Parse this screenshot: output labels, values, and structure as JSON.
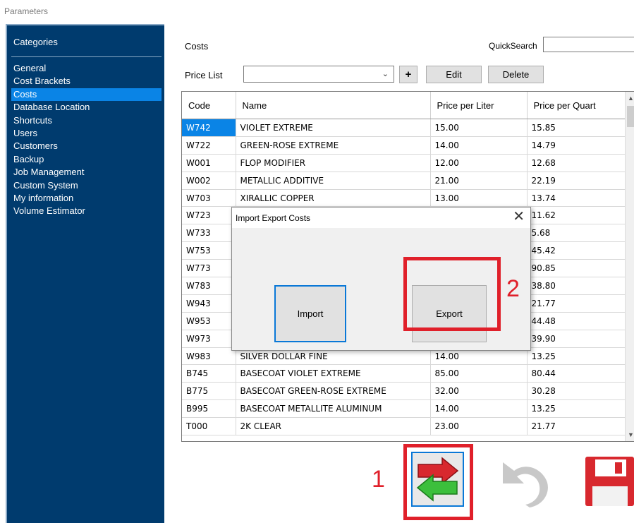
{
  "window": {
    "title": "Parameters"
  },
  "sidebar": {
    "title": "Categories",
    "items": [
      {
        "label": "General"
      },
      {
        "label": "Cost Brackets"
      },
      {
        "label": "Costs",
        "selected": true
      },
      {
        "label": "Database Location"
      },
      {
        "label": "Shortcuts"
      },
      {
        "label": "Users"
      },
      {
        "label": "Customers"
      },
      {
        "label": "Backup"
      },
      {
        "label": "Job Management"
      },
      {
        "label": "Custom System"
      },
      {
        "label": "My information"
      },
      {
        "label": "Volume Estimator"
      }
    ]
  },
  "header": {
    "section_title": "Costs",
    "quicksearch_label": "QuickSearch",
    "quicksearch_value": "",
    "price_list_label": "Price List",
    "price_list_value": "",
    "add_label": "+",
    "edit_label": "Edit",
    "delete_label": "Delete"
  },
  "table": {
    "columns": [
      "Code",
      "Name",
      "Price per Liter",
      "Price per Quart"
    ],
    "rows": [
      [
        "W742",
        "VIOLET EXTREME",
        "15.00",
        "15.85"
      ],
      [
        "W722",
        "GREEN-ROSE EXTREME",
        "14.00",
        "14.79"
      ],
      [
        "W001",
        "FLOP MODIFIER",
        "12.00",
        "12.68"
      ],
      [
        "W002",
        "METALLIC ADDITIVE",
        "21.00",
        "22.19"
      ],
      [
        "W703",
        "XIRALLIC COPPER",
        "13.00",
        "13.74"
      ],
      [
        "W723",
        "",
        "",
        "11.62"
      ],
      [
        "W733",
        "",
        "",
        "5.68"
      ],
      [
        "W753",
        "",
        "",
        "45.42"
      ],
      [
        "W773",
        "",
        "",
        "90.85"
      ],
      [
        "W783",
        "",
        "",
        "38.80"
      ],
      [
        "W943",
        "",
        "",
        "21.77"
      ],
      [
        "W953",
        "",
        "",
        "44.48"
      ],
      [
        "W973",
        "",
        "",
        "39.90"
      ],
      [
        "W983",
        "SILVER DOLLAR FINE",
        "14.00",
        "13.25"
      ],
      [
        "B745",
        "BASECOAT VIOLET EXTREME",
        "85.00",
        "80.44"
      ],
      [
        "B775",
        "BASECOAT GREEN-ROSE EXTREME",
        "32.00",
        "30.28"
      ],
      [
        "B995",
        "BASECOAT METALLITE ALUMINUM",
        "14.00",
        "13.25"
      ],
      [
        "T000",
        "2K CLEAR",
        "23.00",
        "21.77"
      ]
    ],
    "selected_row": 0
  },
  "dialog": {
    "title": "Import Export Costs",
    "close_glyph": "✕",
    "import_label": "Import",
    "export_label": "Export"
  },
  "annotations": {
    "step1": "1",
    "step2": "2",
    "color": "#e0202a"
  },
  "toolbar": {
    "icons": [
      "import-export-icon",
      "undo-icon",
      "save-icon"
    ]
  }
}
